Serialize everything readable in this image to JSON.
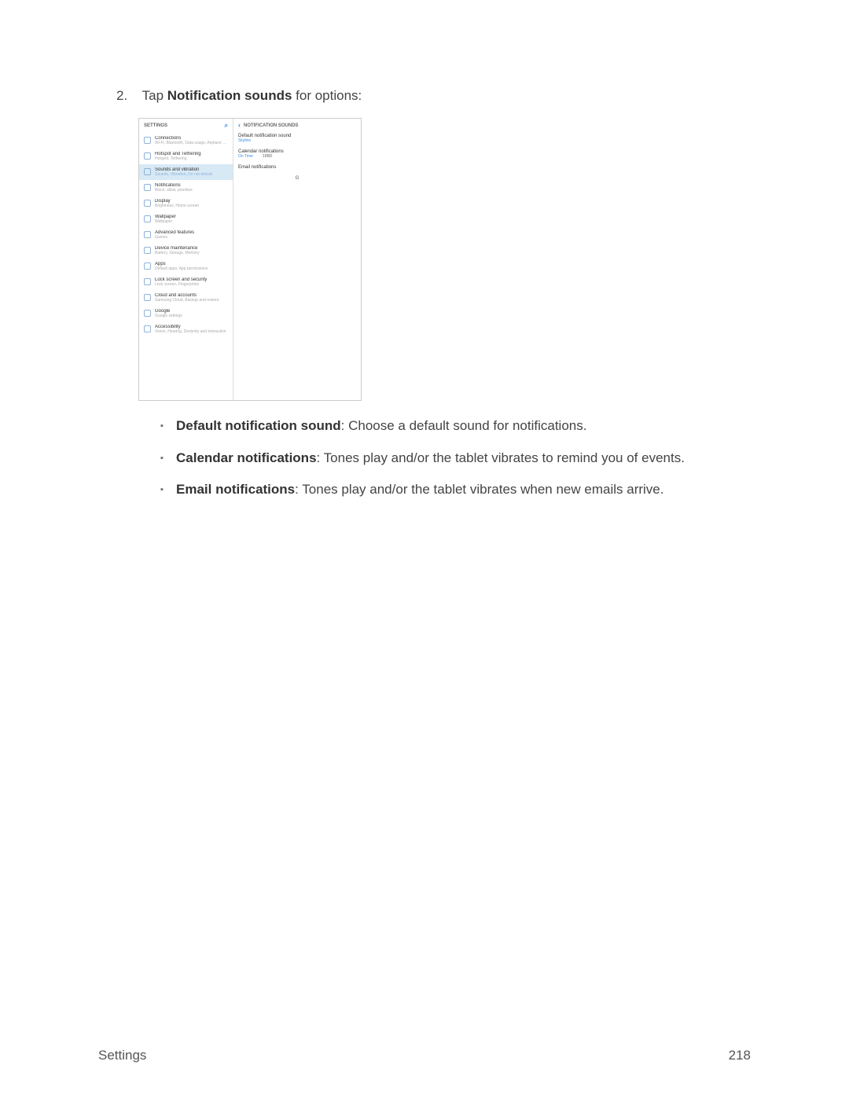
{
  "step": {
    "number": "2.",
    "prefix": "Tap ",
    "bold": "Notification sounds",
    "suffix": " for options:"
  },
  "mock": {
    "left_header": "SETTINGS",
    "items": [
      {
        "title": "Connections",
        "sub": "Wi-Fi, Bluetooth, Data usage, Airplane m..."
      },
      {
        "title": "Hotspot and Tethering",
        "sub": "Hotspot, Tethering"
      },
      {
        "title": "Sounds and vibration",
        "sub": "Sounds, Vibration, Do not disturb",
        "selected": true
      },
      {
        "title": "Notifications",
        "sub": "Block, allow, prioritize"
      },
      {
        "title": "Display",
        "sub": "Brightness, Home screen"
      },
      {
        "title": "Wallpaper",
        "sub": "Wallpaper"
      },
      {
        "title": "Advanced features",
        "sub": "Games"
      },
      {
        "title": "Device maintenance",
        "sub": "Battery, Storage, Memory"
      },
      {
        "title": "Apps",
        "sub": "Default apps, App permissions"
      },
      {
        "title": "Lock screen and security",
        "sub": "Lock screen, Fingerprints"
      },
      {
        "title": "Cloud and accounts",
        "sub": "Samsung Cloud, Backup and restore"
      },
      {
        "title": "Google",
        "sub": "Google settings"
      },
      {
        "title": "Accessibility",
        "sub": "Vision, Hearing, Dexterity and interaction"
      }
    ],
    "right_header": "NOTIFICATION SOUNDS",
    "right_rows": [
      {
        "title": "Default notification sound",
        "sub": "Skyline"
      },
      {
        "title": "Calendar notifications",
        "sub": "On Time",
        "note": "19BD"
      },
      {
        "title": "Email notifications"
      }
    ],
    "stray": "G"
  },
  "bullets": [
    {
      "bold": "Default notification sound",
      "text": ": Choose a default sound for notifications."
    },
    {
      "bold": "Calendar notifications",
      "text": ": Tones play and/or the tablet vibrates to remind you of events."
    },
    {
      "bold": "Email notifications",
      "text": ": Tones play and/or the tablet vibrates when new emails arrive."
    }
  ],
  "footer": {
    "section": "Settings",
    "page": "218"
  }
}
